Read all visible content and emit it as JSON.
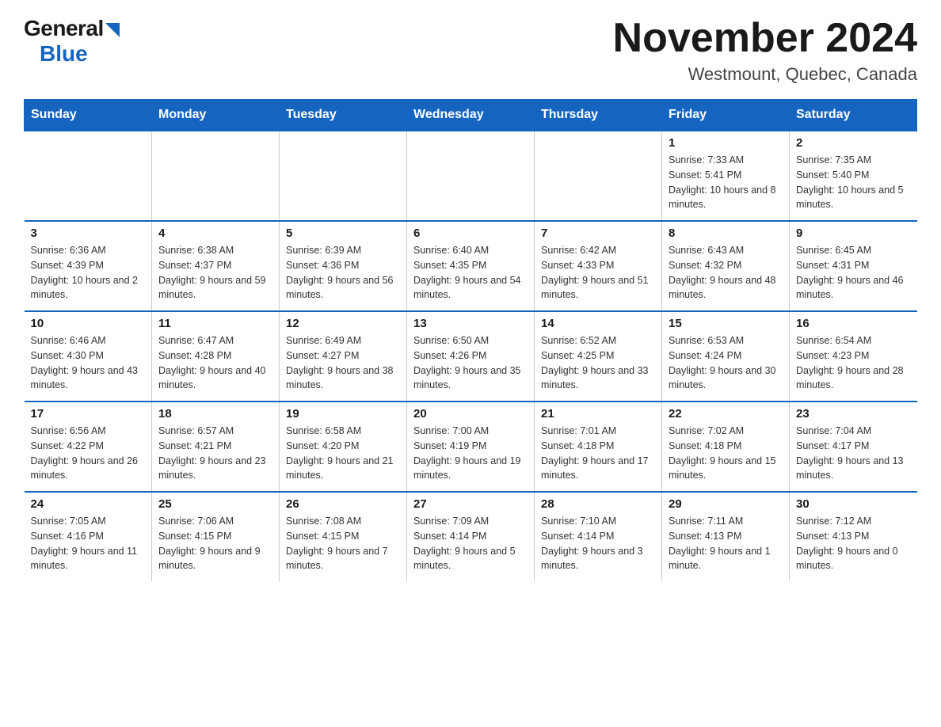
{
  "header": {
    "logo": {
      "general": "General",
      "blue": "Blue"
    },
    "title": "November 2024",
    "subtitle": "Westmount, Quebec, Canada"
  },
  "calendar": {
    "days_of_week": [
      "Sunday",
      "Monday",
      "Tuesday",
      "Wednesday",
      "Thursday",
      "Friday",
      "Saturday"
    ],
    "weeks": [
      [
        {
          "day": "",
          "info": "",
          "empty": true
        },
        {
          "day": "",
          "info": "",
          "empty": true
        },
        {
          "day": "",
          "info": "",
          "empty": true
        },
        {
          "day": "",
          "info": "",
          "empty": true
        },
        {
          "day": "",
          "info": "",
          "empty": true
        },
        {
          "day": "1",
          "info": "Sunrise: 7:33 AM\nSunset: 5:41 PM\nDaylight: 10 hours and 8 minutes."
        },
        {
          "day": "2",
          "info": "Sunrise: 7:35 AM\nSunset: 5:40 PM\nDaylight: 10 hours and 5 minutes."
        }
      ],
      [
        {
          "day": "3",
          "info": "Sunrise: 6:36 AM\nSunset: 4:39 PM\nDaylight: 10 hours and 2 minutes."
        },
        {
          "day": "4",
          "info": "Sunrise: 6:38 AM\nSunset: 4:37 PM\nDaylight: 9 hours and 59 minutes."
        },
        {
          "day": "5",
          "info": "Sunrise: 6:39 AM\nSunset: 4:36 PM\nDaylight: 9 hours and 56 minutes."
        },
        {
          "day": "6",
          "info": "Sunrise: 6:40 AM\nSunset: 4:35 PM\nDaylight: 9 hours and 54 minutes."
        },
        {
          "day": "7",
          "info": "Sunrise: 6:42 AM\nSunset: 4:33 PM\nDaylight: 9 hours and 51 minutes."
        },
        {
          "day": "8",
          "info": "Sunrise: 6:43 AM\nSunset: 4:32 PM\nDaylight: 9 hours and 48 minutes."
        },
        {
          "day": "9",
          "info": "Sunrise: 6:45 AM\nSunset: 4:31 PM\nDaylight: 9 hours and 46 minutes."
        }
      ],
      [
        {
          "day": "10",
          "info": "Sunrise: 6:46 AM\nSunset: 4:30 PM\nDaylight: 9 hours and 43 minutes."
        },
        {
          "day": "11",
          "info": "Sunrise: 6:47 AM\nSunset: 4:28 PM\nDaylight: 9 hours and 40 minutes."
        },
        {
          "day": "12",
          "info": "Sunrise: 6:49 AM\nSunset: 4:27 PM\nDaylight: 9 hours and 38 minutes."
        },
        {
          "day": "13",
          "info": "Sunrise: 6:50 AM\nSunset: 4:26 PM\nDaylight: 9 hours and 35 minutes."
        },
        {
          "day": "14",
          "info": "Sunrise: 6:52 AM\nSunset: 4:25 PM\nDaylight: 9 hours and 33 minutes."
        },
        {
          "day": "15",
          "info": "Sunrise: 6:53 AM\nSunset: 4:24 PM\nDaylight: 9 hours and 30 minutes."
        },
        {
          "day": "16",
          "info": "Sunrise: 6:54 AM\nSunset: 4:23 PM\nDaylight: 9 hours and 28 minutes."
        }
      ],
      [
        {
          "day": "17",
          "info": "Sunrise: 6:56 AM\nSunset: 4:22 PM\nDaylight: 9 hours and 26 minutes."
        },
        {
          "day": "18",
          "info": "Sunrise: 6:57 AM\nSunset: 4:21 PM\nDaylight: 9 hours and 23 minutes."
        },
        {
          "day": "19",
          "info": "Sunrise: 6:58 AM\nSunset: 4:20 PM\nDaylight: 9 hours and 21 minutes."
        },
        {
          "day": "20",
          "info": "Sunrise: 7:00 AM\nSunset: 4:19 PM\nDaylight: 9 hours and 19 minutes."
        },
        {
          "day": "21",
          "info": "Sunrise: 7:01 AM\nSunset: 4:18 PM\nDaylight: 9 hours and 17 minutes."
        },
        {
          "day": "22",
          "info": "Sunrise: 7:02 AM\nSunset: 4:18 PM\nDaylight: 9 hours and 15 minutes."
        },
        {
          "day": "23",
          "info": "Sunrise: 7:04 AM\nSunset: 4:17 PM\nDaylight: 9 hours and 13 minutes."
        }
      ],
      [
        {
          "day": "24",
          "info": "Sunrise: 7:05 AM\nSunset: 4:16 PM\nDaylight: 9 hours and 11 minutes."
        },
        {
          "day": "25",
          "info": "Sunrise: 7:06 AM\nSunset: 4:15 PM\nDaylight: 9 hours and 9 minutes."
        },
        {
          "day": "26",
          "info": "Sunrise: 7:08 AM\nSunset: 4:15 PM\nDaylight: 9 hours and 7 minutes."
        },
        {
          "day": "27",
          "info": "Sunrise: 7:09 AM\nSunset: 4:14 PM\nDaylight: 9 hours and 5 minutes."
        },
        {
          "day": "28",
          "info": "Sunrise: 7:10 AM\nSunset: 4:14 PM\nDaylight: 9 hours and 3 minutes."
        },
        {
          "day": "29",
          "info": "Sunrise: 7:11 AM\nSunset: 4:13 PM\nDaylight: 9 hours and 1 minute."
        },
        {
          "day": "30",
          "info": "Sunrise: 7:12 AM\nSunset: 4:13 PM\nDaylight: 9 hours and 0 minutes."
        }
      ]
    ]
  }
}
